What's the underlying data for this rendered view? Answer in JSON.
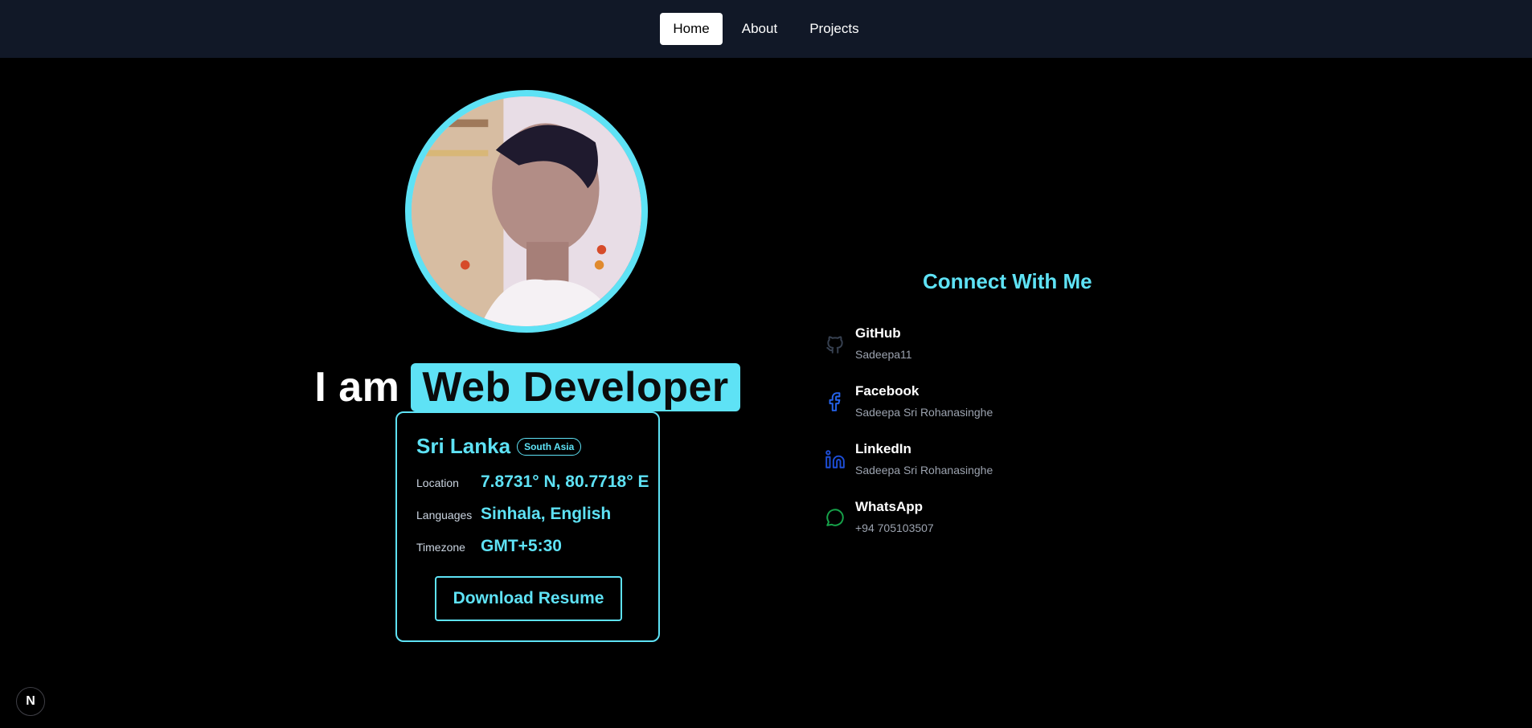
{
  "nav": {
    "items": [
      {
        "label": "Home",
        "active": true
      },
      {
        "label": "About",
        "active": false
      },
      {
        "label": "Projects",
        "active": false
      }
    ]
  },
  "hero": {
    "prefix": "I am",
    "role": "Web Developer",
    "avatar_icon": "profile-photo"
  },
  "info_card": {
    "country": "Sri Lanka",
    "region": "South Asia",
    "rows": [
      {
        "label": "Location",
        "value": "7.8731° N, 80.7718° E"
      },
      {
        "label": "Languages",
        "value": "Sinhala, English"
      },
      {
        "label": "Timezone",
        "value": "GMT+5:30"
      }
    ],
    "button_label": "Download Resume"
  },
  "connect": {
    "title": "Connect With Me",
    "items": [
      {
        "name": "GitHub",
        "handle": "Sadeepa11",
        "icon": "github-icon",
        "color": "#374151"
      },
      {
        "name": "Facebook",
        "handle": "Sadeepa Sri Rohanasinghe",
        "icon": "facebook-icon",
        "color": "#2563eb"
      },
      {
        "name": "LinkedIn",
        "handle": "Sadeepa Sri Rohanasinghe",
        "icon": "linkedin-icon",
        "color": "#1d4ed8"
      },
      {
        "name": "WhatsApp",
        "handle": "+94 705103507",
        "icon": "whatsapp-icon",
        "color": "#16a34a"
      }
    ]
  },
  "dev_badge": {
    "label": "N",
    "icon": "nextjs-icon"
  },
  "colors": {
    "accent": "#5ee2f5",
    "nav_bg": "#111827",
    "page_bg": "#000000"
  }
}
